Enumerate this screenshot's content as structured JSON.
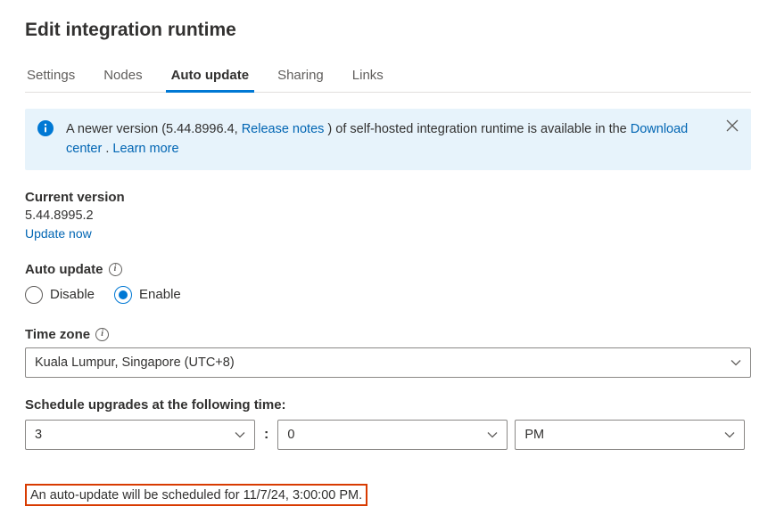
{
  "page_title": "Edit integration runtime",
  "tabs": [
    {
      "label": "Settings",
      "active": false
    },
    {
      "label": "Nodes",
      "active": false
    },
    {
      "label": "Auto update",
      "active": true
    },
    {
      "label": "Sharing",
      "active": false
    },
    {
      "label": "Links",
      "active": false
    }
  ],
  "banner": {
    "text_before_version": "A newer version (",
    "new_version": "5.44.8996.4",
    "text_after_version": ", ",
    "release_notes_label": "Release notes",
    "text_after_release": " ) of self-hosted integration runtime is available in the ",
    "download_center_label": "Download center",
    "text_after_download": " . ",
    "learn_more_label": "Learn more"
  },
  "current_version": {
    "label": "Current version",
    "value": "5.44.8995.2",
    "update_now_label": "Update now"
  },
  "auto_update": {
    "label": "Auto update",
    "options": {
      "disable": "Disable",
      "enable": "Enable"
    },
    "selected": "enable"
  },
  "time_zone": {
    "label": "Time zone",
    "value": "Kuala Lumpur, Singapore (UTC+8)"
  },
  "schedule": {
    "label": "Schedule upgrades at the following time:",
    "hour": "3",
    "minute": "0",
    "ampm": "PM",
    "colon": ":"
  },
  "schedule_note": "An auto-update will be scheduled for 11/7/24, 3:00:00 PM."
}
